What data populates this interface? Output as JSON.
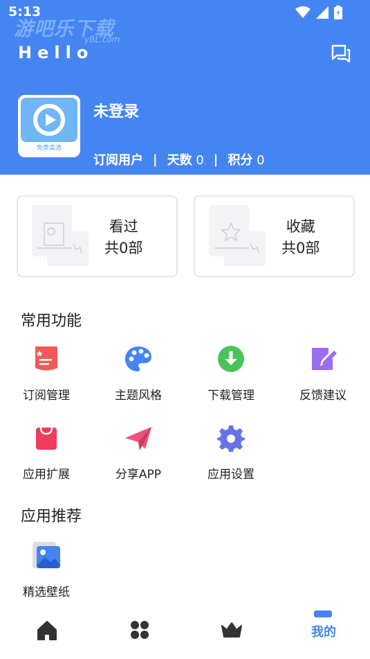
{
  "status": {
    "time": "5:13"
  },
  "watermark": {
    "text": "游吧乐下载",
    "url": "yBL.com"
  },
  "header": {
    "greeting": "Hello"
  },
  "user": {
    "avatar_caption": "免费高清",
    "name": "未登录",
    "type": "订阅用户",
    "days_label": "天数",
    "days_value": "0",
    "points_label": "积分",
    "points_value": "0"
  },
  "cards": [
    {
      "title": "看过",
      "count": "共0部"
    },
    {
      "title": "收藏",
      "count": "共0部"
    }
  ],
  "common": {
    "title": "常用功能",
    "items": [
      {
        "label": "订阅管理",
        "icon": "subscription-icon"
      },
      {
        "label": "主题风格",
        "icon": "palette-icon"
      },
      {
        "label": "下载管理",
        "icon": "download-icon"
      },
      {
        "label": "反馈建议",
        "icon": "feedback-edit-icon"
      },
      {
        "label": "应用扩展",
        "icon": "shopping-bag-icon"
      },
      {
        "label": "分享APP",
        "icon": "paper-plane-icon"
      },
      {
        "label": "应用设置",
        "icon": "settings-gear-icon"
      }
    ]
  },
  "recommend": {
    "title": "应用推荐",
    "items": [
      {
        "label": "精选壁纸",
        "icon": "wallpaper-icon"
      }
    ]
  },
  "tabbar": {
    "active_label": "我的"
  },
  "colors": {
    "primary": "#4585f2",
    "red": "#f05a5a",
    "green": "#4cc35a",
    "purple": "#9b6cf0",
    "pink": "#f0507a",
    "indigo": "#6673e8"
  }
}
